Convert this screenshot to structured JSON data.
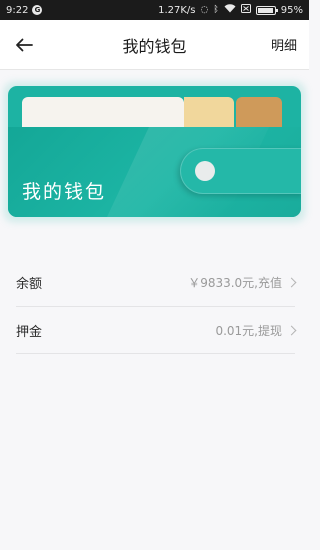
{
  "status_bar": {
    "time": "9:22",
    "network_speed": "1.27K/s",
    "battery_percent": "95%",
    "battery_level": 0.95
  },
  "nav": {
    "title": "我的钱包",
    "action": "明细"
  },
  "wallet_card": {
    "title": "我的钱包",
    "colors": {
      "primary": "#1db3a3",
      "paper_white": "#f6f3ee",
      "paper_beige": "#f1d79c",
      "paper_brown": "#cf9a5a"
    }
  },
  "list": {
    "items": [
      {
        "label": "余额",
        "value": "￥9833.0元,充值"
      },
      {
        "label": "押金",
        "value": "0.01元,提现"
      }
    ]
  }
}
